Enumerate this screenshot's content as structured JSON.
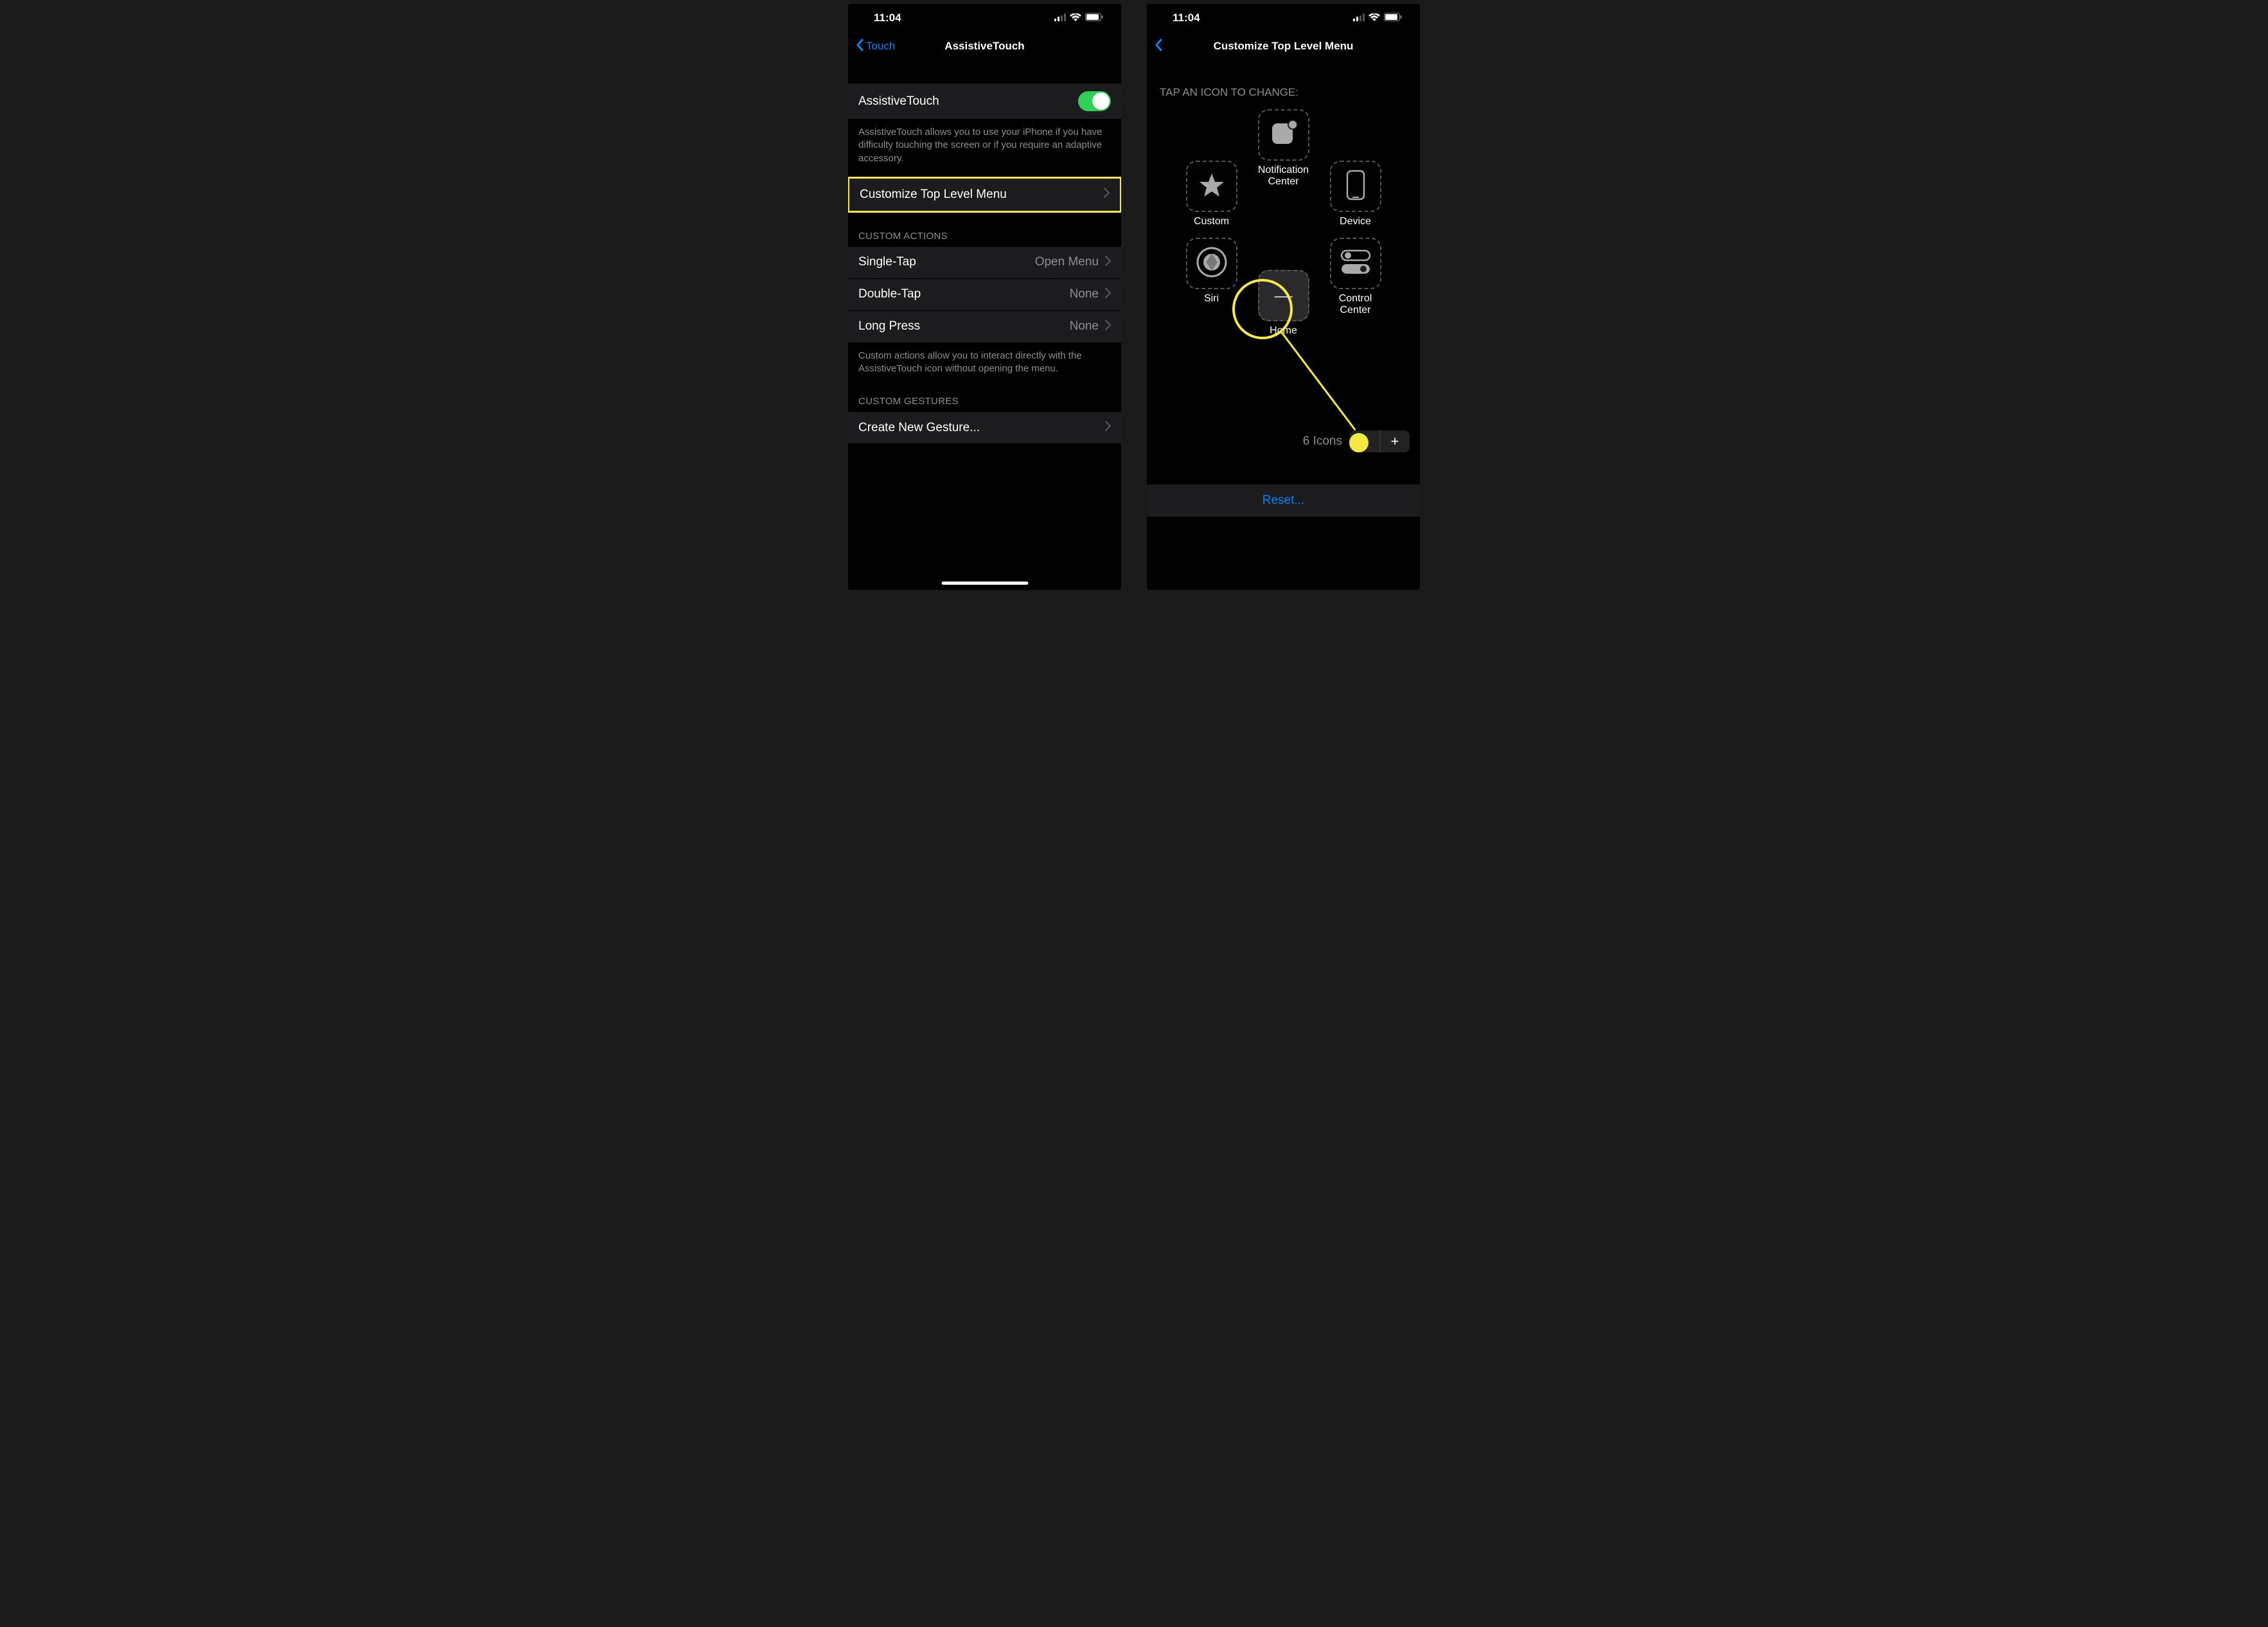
{
  "status": {
    "time": "11:04"
  },
  "left": {
    "back_label": "Touch",
    "title": "AssistiveTouch",
    "toggle_row": {
      "label": "AssistiveTouch"
    },
    "toggle_footer": "AssistiveTouch allows you to use your iPhone if you have difficulty touching the screen or if you require an adaptive accessory.",
    "customize_row": "Customize Top Level Menu",
    "custom_actions_header": "CUSTOM ACTIONS",
    "actions": {
      "single": {
        "label": "Single-Tap",
        "value": "Open Menu"
      },
      "double": {
        "label": "Double-Tap",
        "value": "None"
      },
      "long": {
        "label": "Long Press",
        "value": "None"
      }
    },
    "actions_footer": "Custom actions allow you to interact directly with the AssistiveTouch icon without opening the menu.",
    "custom_gestures_header": "CUSTOM GESTURES",
    "gesture_row": "Create New Gesture..."
  },
  "right": {
    "title": "Customize Top Level Menu",
    "tap_label": "TAP AN ICON TO CHANGE:",
    "icons": {
      "notification": "Notification Center",
      "custom": "Custom",
      "device": "Device",
      "siri": "Siri",
      "control": "Control Center",
      "home": "Home"
    },
    "counter": "6 Icons",
    "reset": "Reset..."
  }
}
